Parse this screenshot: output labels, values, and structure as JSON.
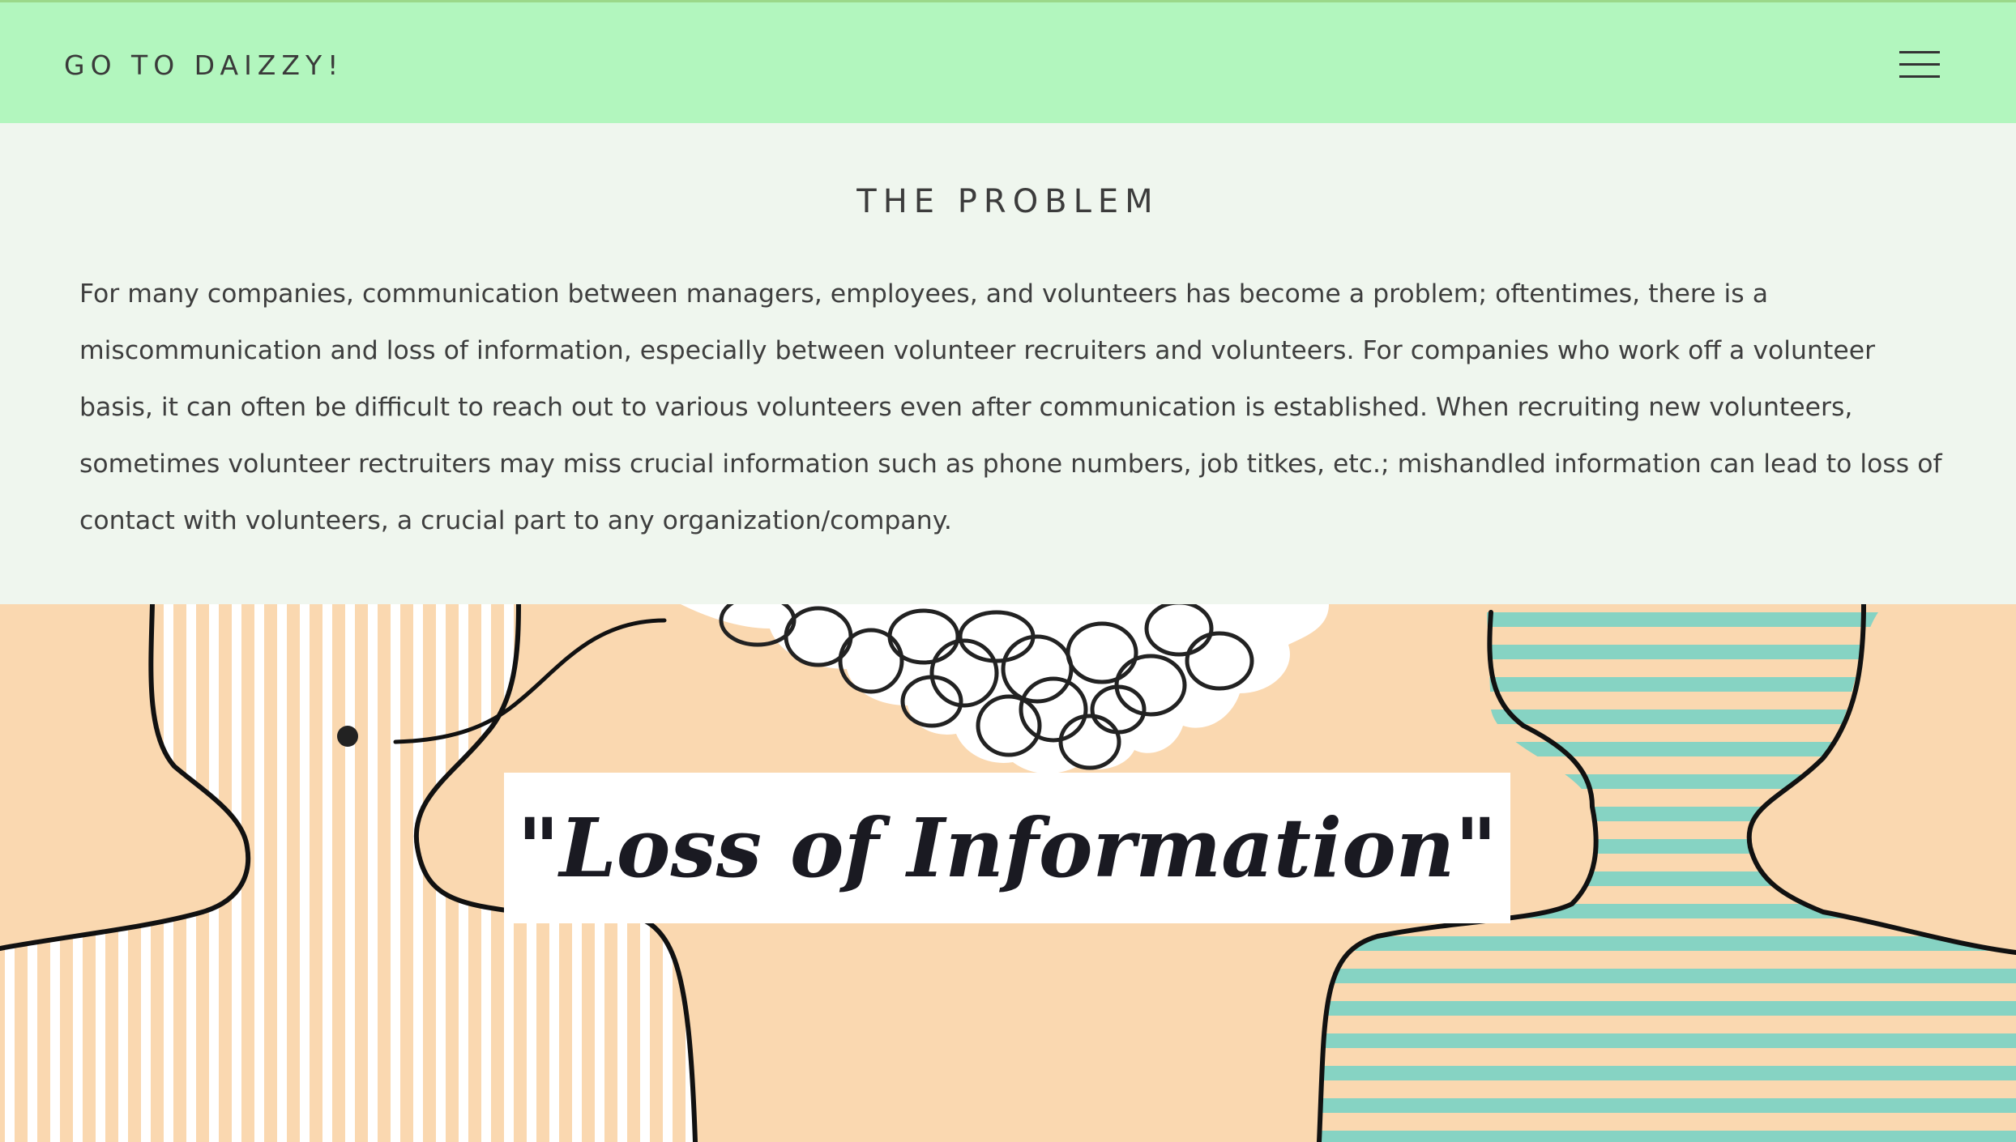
{
  "nav": {
    "brand": "GO TO DAIZZY!",
    "menu_icon": "hamburger-menu-icon"
  },
  "problem": {
    "title": "THE PROBLEM",
    "body": "For many companies, communication between managers, employees, and volunteers has become a problem; oftentimes, there is a miscommunication and loss of information, especially between volunteer recruiters and volunteers. For companies who work off a volunteer basis, it can often be difficult to reach out to various volunteers even after communication is established. When recruiting new volunteers, sometimes volunteer rectruiters may miss crucial information such as phone numbers, job titkes, etc.; mishandled information can lead to loss of contact with volunteers, a crucial part to any organization/company."
  },
  "hero": {
    "banner_text": "\"Loss of Information\"",
    "illustration": "two-people-tangled-thought-illustration"
  },
  "colors": {
    "nav_bg": "#b2f6be",
    "section_bg": "#eff6ee",
    "hero_bg": "#fad8b0",
    "stripe_teal": "#86d3c3",
    "outline": "#111111"
  }
}
